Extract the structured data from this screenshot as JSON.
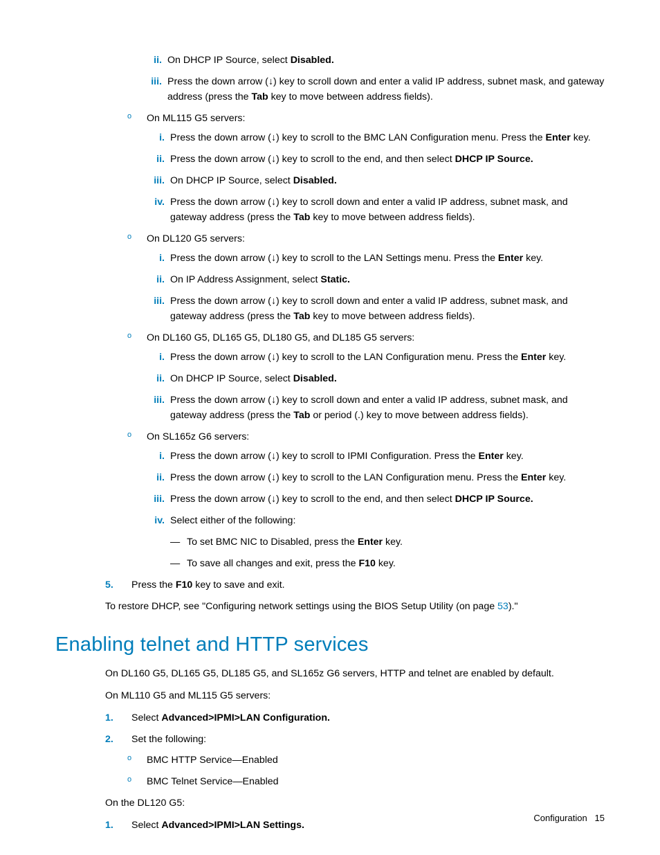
{
  "top": {
    "roman2": [
      {
        "n": "ii.",
        "html": "On DHCP IP Source, select <b>Disabled.</b>"
      },
      {
        "n": "iii.",
        "html": "Press the down arrow (↓) key to scroll down and enter a valid IP address, subnet mask, and gateway address (press the <b>Tab</b> key to move between address fields)."
      }
    ],
    "bullets": [
      {
        "label": "On ML115 G5 servers:",
        "roman": [
          {
            "n": "i.",
            "html": "Press the down arrow (↓) key to scroll to the BMC LAN Configuration menu. Press the <b>Enter</b> key."
          },
          {
            "n": "ii.",
            "html": "Press the down arrow (↓) key to scroll to the end, and then select <b>DHCP IP Source.</b>"
          },
          {
            "n": "iii.",
            "html": "On DHCP IP Source, select <b>Disabled.</b>"
          },
          {
            "n": "iv.",
            "html": "Press the down arrow (↓) key to scroll down and enter a valid IP address, subnet mask, and gateway address (press the <b>Tab</b> key to move between address fields)."
          }
        ]
      },
      {
        "label": "On DL120 G5 servers:",
        "roman": [
          {
            "n": "i.",
            "html": "Press the down arrow (↓) key to scroll to the LAN Settings menu. Press the <b>Enter</b> key."
          },
          {
            "n": "ii.",
            "html": "On IP Address Assignment, select <b>Static.</b>"
          },
          {
            "n": "iii.",
            "html": "Press the down arrow (↓) key to scroll down and enter a valid IP address, subnet mask, and gateway address (press the <b>Tab</b> key to move between address fields)."
          }
        ]
      },
      {
        "label": "On DL160 G5, DL165 G5, DL180 G5, and DL185 G5 servers:",
        "roman": [
          {
            "n": "i.",
            "html": "Press the down arrow (↓) key to scroll to the LAN Configuration menu. Press the <b>Enter</b> key."
          },
          {
            "n": "ii.",
            "html": "On DHCP IP Source, select <b>Disabled.</b>"
          },
          {
            "n": "iii.",
            "html": "Press the down arrow (↓) key to scroll down and enter a valid IP address, subnet mask, and gateway address (press the <b>Tab</b> or period (.) key to move between address fields)."
          }
        ]
      },
      {
        "label": "On SL165z G6 servers:",
        "roman": [
          {
            "n": "i.",
            "html": "Press the down arrow (↓) key to scroll to IPMI Configuration. Press the <b>Enter</b> key."
          },
          {
            "n": "ii.",
            "html": "Press the down arrow (↓) key to scroll to the LAN Configuration menu. Press the <b>Enter</b> key."
          },
          {
            "n": "iii.",
            "html": "Press the down arrow (↓) key to scroll to the end, and then select <b>DHCP IP Source.</b>"
          },
          {
            "n": "iv.",
            "html": "Select either of the following:"
          }
        ],
        "dash": [
          "To set BMC NIC to Disabled, press the <b>Enter</b> key.",
          "To save all changes and exit, press the <b>F10</b> key."
        ]
      }
    ],
    "step5": "Press the <b>F10</b> key to save and exit.",
    "restore": "To restore DHCP, see \"Configuring network settings using the BIOS Setup Utility (on page <span class='link'>53</span>).\""
  },
  "heading": "Enabling telnet and HTTP services",
  "section": {
    "p1": "On DL160 G5, DL165 G5, DL185 G5, and SL165z G6 servers, HTTP and telnet are enabled by default.",
    "p2": "On ML110 G5 and ML115 G5 servers:",
    "ol1": [
      {
        "n": "1.",
        "html": "Select <b>Advanced>IPMI>LAN Configuration.</b>"
      },
      {
        "n": "2.",
        "html": "Set the following:",
        "sub": [
          "BMC HTTP Service—Enabled",
          "BMC Telnet Service—Enabled"
        ]
      }
    ],
    "p3": "On the DL120 G5:",
    "ol2": [
      {
        "n": "1.",
        "html": "Select <b>Advanced>IPMI>LAN Settings.</b>"
      }
    ]
  },
  "footer": {
    "label": "Configuration",
    "page": "15"
  }
}
